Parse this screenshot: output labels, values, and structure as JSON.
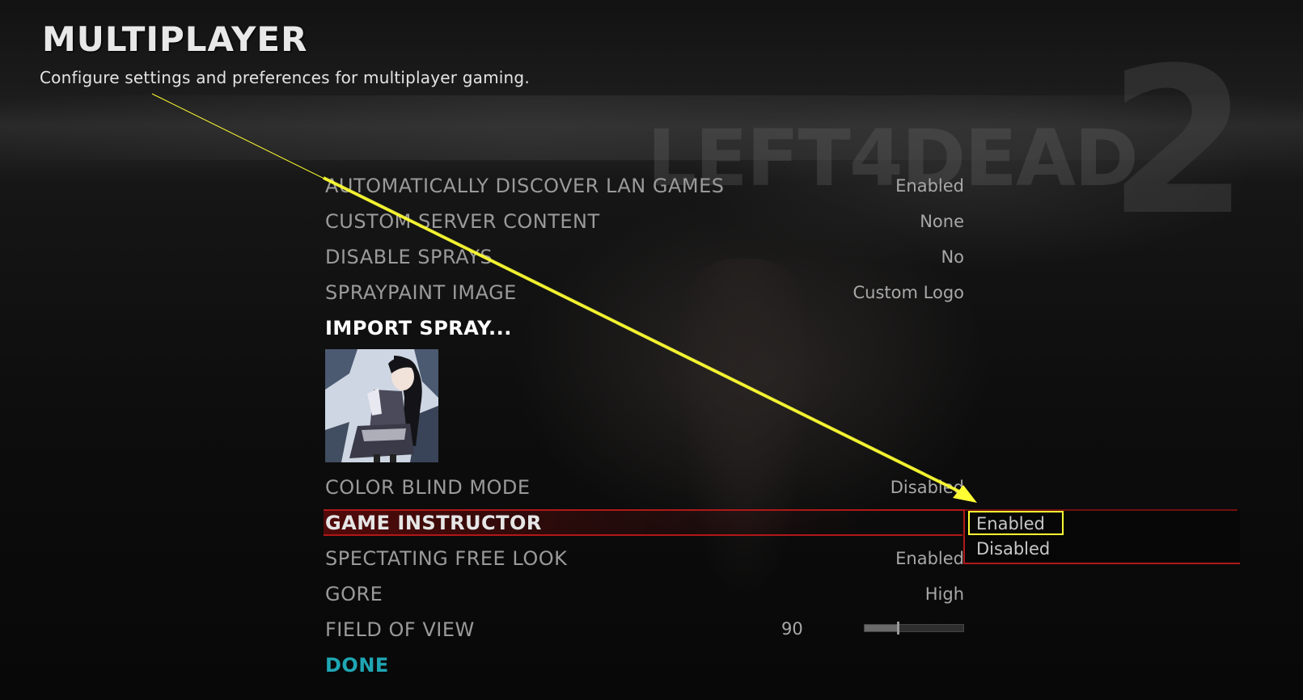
{
  "header": {
    "title": "MULTIPLAYER",
    "subtitle": "Configure settings and preferences for multiplayer gaming."
  },
  "background_logo": {
    "text": "LEFT4DEAD",
    "number": "2"
  },
  "settings": [
    {
      "label": "AUTOMATICALLY DISCOVER LAN GAMES",
      "value": "Enabled"
    },
    {
      "label": "CUSTOM SERVER CONTENT",
      "value": "None"
    },
    {
      "label": "DISABLE SPRAYS",
      "value": "No"
    },
    {
      "label": "SPRAYPAINT IMAGE",
      "value": "Custom Logo"
    }
  ],
  "import_spray_label": "IMPORT SPRAY...",
  "settings2": [
    {
      "label": "COLOR BLIND MODE",
      "value": "Disabled"
    },
    {
      "label": "GAME INSTRUCTOR",
      "value": ""
    },
    {
      "label": "SPECTATING FREE LOOK",
      "value": "Enabled"
    },
    {
      "label": "GORE",
      "value": "High"
    }
  ],
  "fov": {
    "label": "FIELD OF VIEW",
    "value": "90",
    "slider_fraction": 0.34
  },
  "done_label": "DONE",
  "dropdown": {
    "options": [
      "Enabled",
      "Disabled"
    ],
    "highlighted": "Enabled"
  },
  "colors": {
    "selection_red": "#b01818",
    "annotation_yellow": "#ffff33",
    "done_teal": "#1fa6b4"
  }
}
